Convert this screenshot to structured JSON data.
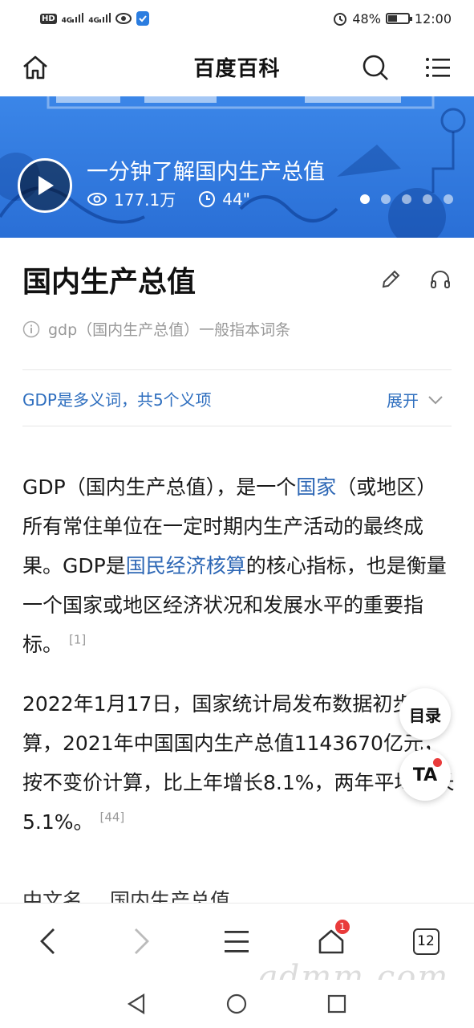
{
  "status_bar": {
    "network_badge": "HD",
    "signal_1": "4G",
    "signal_2": "4G",
    "battery_percent": "48%",
    "battery_level": 0.48,
    "time": "12:00"
  },
  "header": {
    "title": "百度百科",
    "home_icon": "home-icon",
    "search_icon": "search-icon",
    "menu_icon": "menu-icon"
  },
  "banner": {
    "video_title": "一分钟了解国内生产总值",
    "views": "177.1万",
    "duration": "44\"",
    "slide_count": 5,
    "active_slide": 1
  },
  "entry": {
    "title": "国内生产总值",
    "subtitle": "gdp（国内生产总值）一般指本词条",
    "polysemy": "GDP是多义词，共5个义项",
    "expand_label": "展开"
  },
  "paragraphs": {
    "p1_a": "GDP（国内生产总值），是一个",
    "p1_link1": "国家",
    "p1_b": "（或地区）所有常住单位在一定时期内生产活动的最终成果。GDP是",
    "p1_link2": "国民经济核算",
    "p1_c": "的核心指标，也是衡量一个国家或地区经济状况和发展水平的重要指标。",
    "p1_ref": "[1]",
    "p2_text": "2022年1月17日，国家统计局发布数据初步核算，2021年中国国内生产总值1143670亿元，按不变价计算，比上年增长8.1%，两年平均增长5.1%。",
    "p2_ref": "[44]"
  },
  "info_box": {
    "label": "中文名",
    "value": "国内生产总值"
  },
  "floating": {
    "toc_label": "目录",
    "ta_label": "TA"
  },
  "toolbar": {
    "home_badge": "1",
    "tabs_count": "12"
  },
  "watermark": "gdmm.com"
}
